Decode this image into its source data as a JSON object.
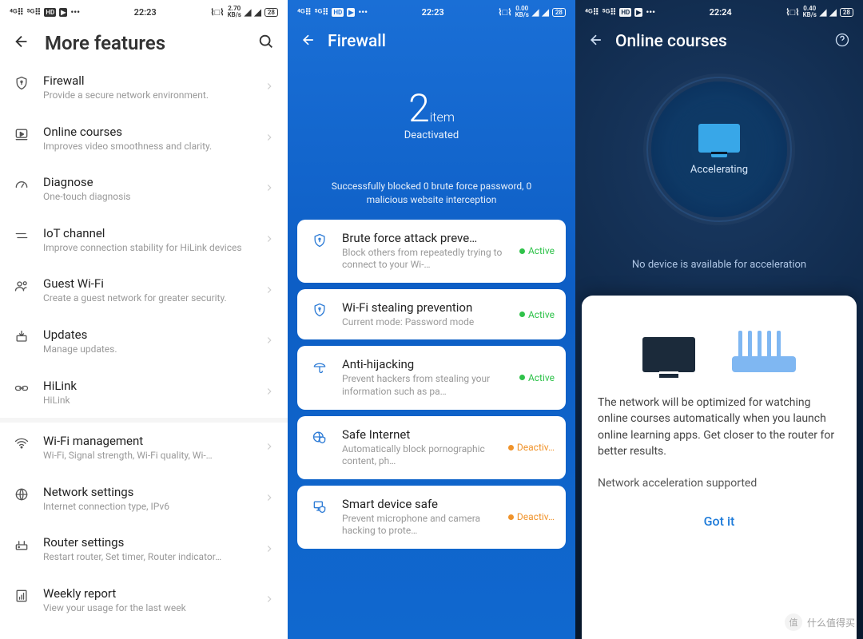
{
  "statusbar": {
    "left_icons": [
      "4G",
      "5G",
      "HD",
      "▶",
      "…"
    ],
    "right_icons": [
      "vib",
      "speed",
      "wifi",
      "wifi",
      "batt"
    ]
  },
  "screens": {
    "more": {
      "time": "22:23",
      "speed": "2.70",
      "speedUnit": "KB/s",
      "battery": "28",
      "title": "More features",
      "items": [
        {
          "icon": "shield",
          "title": "Firewall",
          "sub": "Provide a secure network environment."
        },
        {
          "icon": "play",
          "title": "Online courses",
          "sub": "Improves video smoothness and clarity."
        },
        {
          "icon": "gauge",
          "title": "Diagnose",
          "sub": "One-touch diagnosis"
        },
        {
          "icon": "swap",
          "title": "IoT channel",
          "sub": "Improve connection stability for HiLink devices"
        },
        {
          "icon": "group",
          "title": "Guest Wi-Fi",
          "sub": "Create a guest network for greater security."
        },
        {
          "icon": "update",
          "title": "Updates",
          "sub": "Manage updates."
        },
        {
          "icon": "link",
          "title": "HiLink",
          "sub": "HiLink"
        }
      ],
      "items2": [
        {
          "icon": "wifi",
          "title": "Wi-Fi management",
          "sub": "Wi-Fi, Signal strength, Wi-Fi quality, Wi-…"
        },
        {
          "icon": "globe",
          "title": "Network settings",
          "sub": "Internet connection type, IPv6"
        },
        {
          "icon": "router",
          "title": "Router settings",
          "sub": "Restart router, Set timer, Router indicator…"
        },
        {
          "icon": "report",
          "title": "Weekly report",
          "sub": "View your usage for the last week"
        }
      ]
    },
    "firewall": {
      "time": "22:23",
      "speed": "0.00",
      "speedUnit": "KB/s",
      "battery": "28",
      "title": "Firewall",
      "count": "2",
      "countUnit": "item",
      "countLabel": "Deactivated",
      "message": "Successfully blocked 0 brute force password, 0 malicious website interception",
      "cards": [
        {
          "icon": "shield",
          "title": "Brute force attack preve…",
          "sub": "Block others from repeatedly trying to connect to your Wi-…",
          "status": "Active",
          "kind": "A"
        },
        {
          "icon": "shield",
          "title": "Wi-Fi stealing prevention",
          "sub": "Current mode: Password mode",
          "status": "Active",
          "kind": "A"
        },
        {
          "icon": "umbrella",
          "title": "Anti-hijacking",
          "sub": "Prevent hackers from stealing your information such as pa…",
          "status": "Active",
          "kind": "A"
        },
        {
          "icon": "globe-shield",
          "title": "Safe Internet",
          "sub": "Automatically block pornographic content, ph…",
          "status": "Deactiv…",
          "kind": "D"
        },
        {
          "icon": "device-shield",
          "title": "Smart device safe",
          "sub": "Prevent microphone and camera hacking to prote…",
          "status": "Deactiv…",
          "kind": "D"
        }
      ]
    },
    "courses": {
      "time": "22:24",
      "speed": "0.40",
      "speedUnit": "KB/s",
      "battery": "28",
      "title": "Online courses",
      "ringLabel": "Accelerating",
      "noDevice": "No device is available for acceleration",
      "popup": {
        "body": "The network will be optimized for watching online courses automatically when you launch online learning apps. Get closer to the router for better results.",
        "supported": "Network acceleration supported",
        "button": "Got it"
      }
    }
  },
  "watermark": {
    "text": "什么值得买",
    "icon": "值"
  }
}
